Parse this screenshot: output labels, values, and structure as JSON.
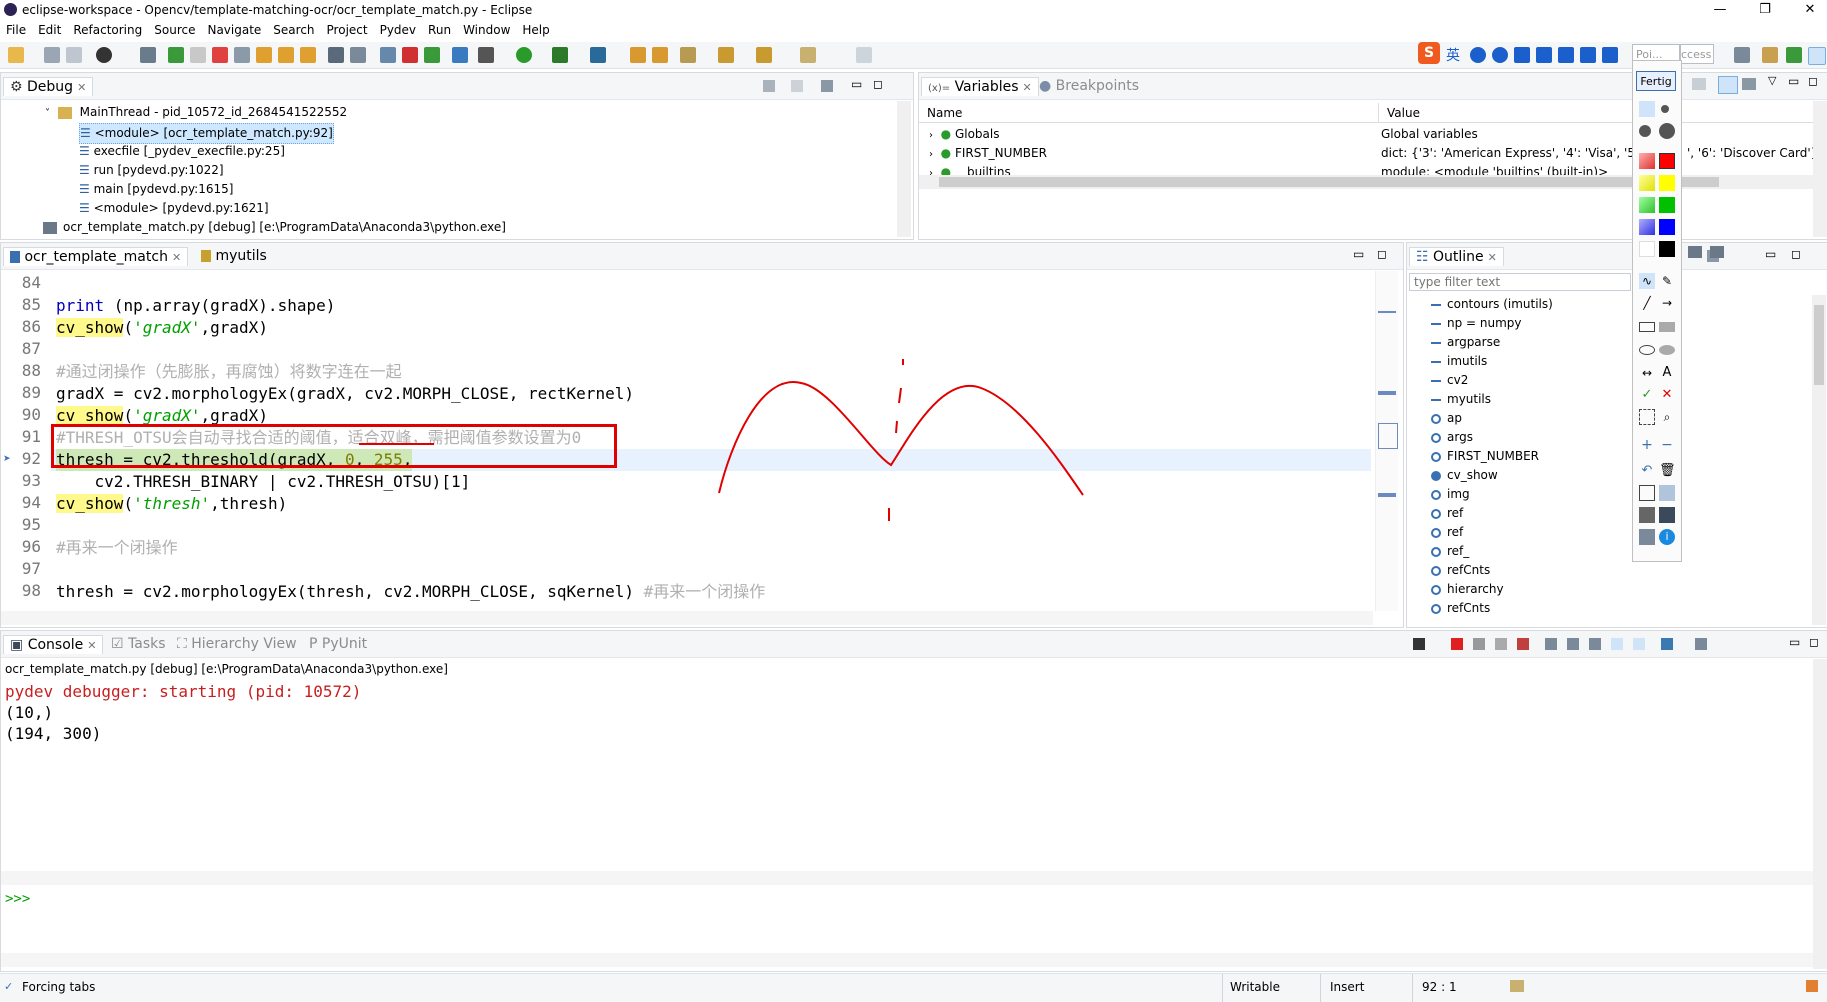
{
  "window": {
    "title": "eclipse-workspace - Opencv/template-matching-ocr/ocr_template_match.py - Eclipse",
    "controls": [
      "—",
      "❐",
      "✕"
    ]
  },
  "menu": [
    "File",
    "Edit",
    "Refactoring",
    "Source",
    "Navigate",
    "Search",
    "Project",
    "Pydev",
    "Run",
    "Window",
    "Help"
  ],
  "ime": {
    "lang": "英"
  },
  "perspective": {
    "input_text": "Poi...",
    "access_label": "ccess"
  },
  "palette": {
    "done_label": "Fertig"
  },
  "debug_view": {
    "tab": "Debug",
    "thread": "MainThread - pid_10572_id_2684541522552",
    "frames": [
      "<module> [ocr_template_match.py:92]",
      "execfile [_pydev_execfile.py:25]",
      "run [pydevd.py:1022]",
      "main [pydevd.py:1615]",
      "<module> [pydevd.py:1621]"
    ],
    "process": "ocr_template_match.py [debug] [e:\\ProgramData\\Anaconda3\\python.exe]"
  },
  "variables_view": {
    "tabs": [
      "Variables",
      "Breakpoints"
    ],
    "col_name": "Name",
    "col_value": "Value",
    "rows": [
      {
        "name": "Globals",
        "value": "Global variables"
      },
      {
        "name": "FIRST_NUMBER",
        "value": "dict: {'3': 'American Express', '4': 'Visa', '5': 'Ma",
        "value2": "', '6': 'Discover Card'}"
      },
      {
        "name": "__builtins__",
        "value": "module: <module 'builtins' (built-in)>"
      }
    ]
  },
  "editor": {
    "tabs": [
      "ocr_template_match",
      "myutils"
    ],
    "lines": [
      {
        "n": "84"
      },
      {
        "n": "85"
      },
      {
        "n": "86"
      },
      {
        "n": "87"
      },
      {
        "n": "88"
      },
      {
        "n": "89"
      },
      {
        "n": "90"
      },
      {
        "n": "91"
      },
      {
        "n": "92"
      },
      {
        "n": "93"
      },
      {
        "n": "94"
      },
      {
        "n": "95"
      },
      {
        "n": "96"
      },
      {
        "n": "97"
      },
      {
        "n": "98"
      }
    ],
    "code": {
      "l85_print": "print",
      "l85_rest": " (np.array(gradX).shape)",
      "l86_fn": "cv_show",
      "l86_str": "'gradX'",
      "l86_rest": ",gradX)",
      "l88_cmt": "#通过闭操作（先膨胀，再腐蚀）将数字连在一起",
      "l89": "gradX = cv2.morphologyEx(gradX, cv2.MORPH_CLOSE, rectKernel)",
      "l90_fn": "cv_show",
      "l90_str": "'gradX'",
      "l90_rest": ",gradX)",
      "l91_cmt": "#THRESH_OTSU会自动寻找合适的阈值，适合双峰，需把阈值参数设置为0",
      "l92_a": "thresh = cv2.threshold(gradX, ",
      "l92_n1": "0",
      "l92_b": ", ",
      "l92_n2": "255",
      "l92_c": ",",
      "l93": "    cv2.THRESH_BINARY | cv2.THRESH_OTSU)[1]",
      "l94_fn": "cv_show",
      "l94_str": "'thresh'",
      "l94_rest": ",thresh)",
      "l96_cmt": "#再来一个闭操作",
      "l98_code": "thresh = cv2.morphologyEx(thresh, cv2.MORPH_CLOSE, sqKernel) ",
      "l98_cmt": "#再来一个闭操作"
    }
  },
  "outline_view": {
    "tab": "Outline",
    "filter_placeholder": "type filter text",
    "items": [
      "contours (imutils)",
      "np = numpy",
      "argparse",
      "imutils",
      "cv2",
      "myutils",
      "ap",
      "args",
      "FIRST_NUMBER",
      "cv_show",
      "img",
      "ref",
      "ref",
      "ref_",
      "refCnts",
      "hierarchy",
      "refCnts"
    ]
  },
  "console_view": {
    "tabs": [
      "Console",
      "Tasks",
      "Hierarchy View",
      "PyUnit"
    ],
    "process": "ocr_template_match.py [debug] [e:\\ProgramData\\Anaconda3\\python.exe]",
    "output": [
      "pydev debugger: starting (pid: 10572)",
      "(10,)",
      "(194, 300)"
    ],
    "prompt": ">>>"
  },
  "status": {
    "left": "Forcing tabs",
    "writable": "Writable",
    "insert": "Insert",
    "position": "92 : 1"
  },
  "colors": {
    "accent": "#0a64c8",
    "annotation_red": "#e00000",
    "string_green": "#00a000",
    "keyword_blue": "#0000c0",
    "console_red": "#c81e1e"
  }
}
